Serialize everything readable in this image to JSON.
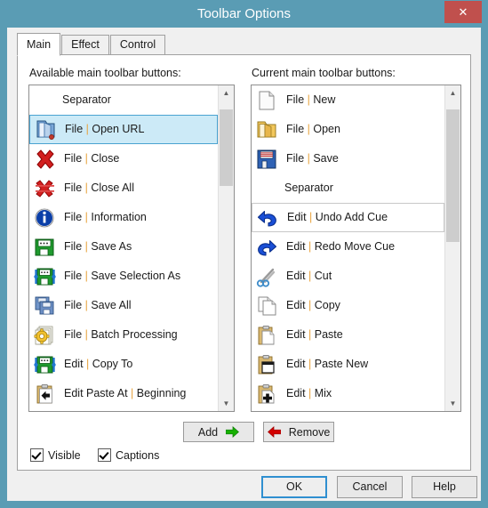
{
  "window": {
    "title": "Toolbar Options",
    "close_label": "✕",
    "frame_color": "#5a9cb4",
    "close_color": "#c0504d",
    "body_color": "#f0f0f0"
  },
  "tabs": [
    {
      "label": "Main",
      "active": true
    },
    {
      "label": "Effect",
      "active": false
    },
    {
      "label": "Control",
      "active": false
    }
  ],
  "available": {
    "label": "Available main toolbar buttons:",
    "items": [
      {
        "text": "Separator",
        "icon": "none",
        "selected": false,
        "separator": true
      },
      {
        "text": "File | Open URL",
        "icon": "open-url-icon",
        "selected": true,
        "separator": false
      },
      {
        "text": "File | Close",
        "icon": "close-red-x-icon",
        "selected": false,
        "separator": false
      },
      {
        "text": "File | Close All",
        "icon": "close-all-red-x-icon",
        "selected": false,
        "separator": false
      },
      {
        "text": "File | Information",
        "icon": "information-icon",
        "selected": false,
        "separator": false
      },
      {
        "text": "File | Save As",
        "icon": "save-as-floppy-icon",
        "selected": false,
        "separator": false
      },
      {
        "text": "File | Save Selection As",
        "icon": "save-selection-as-floppy-icon",
        "selected": false,
        "separator": false
      },
      {
        "text": "File | Save All",
        "icon": "save-all-floppy-icon",
        "selected": false,
        "separator": false
      },
      {
        "text": "File | Batch Processing",
        "icon": "batch-processing-gear-icon",
        "selected": false,
        "separator": false
      },
      {
        "text": "Edit | Copy To",
        "icon": "copy-to-floppy-icon",
        "selected": false,
        "separator": false
      },
      {
        "text": "Edit Paste At | Beginning",
        "icon": "paste-at-beginning-icon",
        "selected": false,
        "separator": false
      }
    ],
    "scroll": {
      "thumb_top_pct": 3,
      "thumb_height_pct": 26
    }
  },
  "current": {
    "label": "Current main toolbar buttons:",
    "items": [
      {
        "text": "File | New",
        "icon": "new-document-icon",
        "selected": false,
        "separator": false
      },
      {
        "text": "File | Open",
        "icon": "open-folder-icon",
        "selected": false,
        "separator": false
      },
      {
        "text": "File | Save",
        "icon": "save-floppy-icon",
        "selected": false,
        "separator": false
      },
      {
        "text": "Separator",
        "icon": "none",
        "selected": false,
        "separator": true
      },
      {
        "text": "Edit | Undo Add Cue",
        "icon": "undo-arrow-icon",
        "selected": true,
        "separator": false
      },
      {
        "text": "Edit | Redo Move Cue",
        "icon": "redo-arrow-icon",
        "selected": false,
        "separator": false
      },
      {
        "text": "Edit | Cut",
        "icon": "scissors-icon",
        "selected": false,
        "separator": false
      },
      {
        "text": "Edit | Copy",
        "icon": "copy-pages-icon",
        "selected": false,
        "separator": false
      },
      {
        "text": "Edit | Paste",
        "icon": "clipboard-paste-icon",
        "selected": false,
        "separator": false
      },
      {
        "text": "Edit | Paste New",
        "icon": "clipboard-paste-new-icon",
        "selected": false,
        "separator": false
      },
      {
        "text": "Edit | Mix",
        "icon": "clipboard-mix-plus-icon",
        "selected": false,
        "separator": false
      }
    ],
    "scroll": {
      "thumb_top_pct": 3,
      "thumb_height_pct": 45
    }
  },
  "transfer": {
    "add_label": "Add",
    "add_icon": "arrow-right-green-icon",
    "remove_label": "Remove",
    "remove_icon": "arrow-left-red-icon",
    "add_arrow_color": "#17b000",
    "remove_arrow_color": "#d40000"
  },
  "options": {
    "visible": {
      "label": "Visible",
      "checked": true
    },
    "captions": {
      "label": "Captions",
      "checked": true
    }
  },
  "footer": {
    "ok_label": "OK",
    "cancel_label": "Cancel",
    "help_label": "Help",
    "default_border_color": "#2f8fd0"
  }
}
